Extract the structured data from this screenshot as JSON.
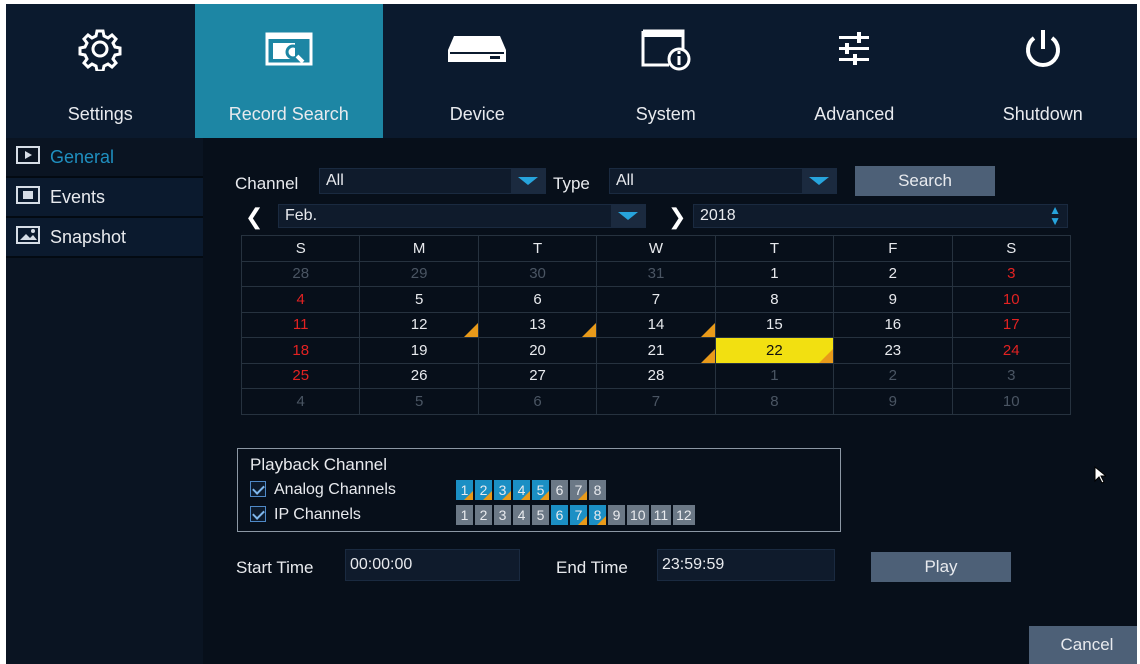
{
  "nav": [
    {
      "label": "Settings",
      "icon": "gear-icon"
    },
    {
      "label": "Record Search",
      "icon": "record-search-icon",
      "active": true
    },
    {
      "label": "Device",
      "icon": "hard-drive-icon"
    },
    {
      "label": "System",
      "icon": "system-info-icon"
    },
    {
      "label": "Advanced",
      "icon": "sliders-icon"
    },
    {
      "label": "Shutdown",
      "icon": "power-icon"
    }
  ],
  "sidebar": [
    {
      "label": "General",
      "icon": "general-icon",
      "active": true
    },
    {
      "label": "Events",
      "icon": "events-icon"
    },
    {
      "label": "Snapshot",
      "icon": "snapshot-icon"
    }
  ],
  "filters": {
    "channel_label": "Channel",
    "channel_value": "All",
    "type_label": "Type",
    "type_value": "All",
    "search_label": "Search"
  },
  "month_nav": {
    "month": "Feb.",
    "year": "2018"
  },
  "calendar": {
    "weekdays": [
      "S",
      "M",
      "T",
      "W",
      "T",
      "F",
      "S"
    ],
    "weeks": [
      [
        "28",
        "29",
        "30",
        "31",
        "1",
        "2",
        "3"
      ],
      [
        "4",
        "5",
        "6",
        "7",
        "8",
        "9",
        "10"
      ],
      [
        "11",
        "12",
        "13",
        "14",
        "15",
        "16",
        "17"
      ],
      [
        "18",
        "19",
        "20",
        "21",
        "22",
        "23",
        "24"
      ],
      [
        "25",
        "26",
        "27",
        "28",
        "1",
        "2",
        "3"
      ],
      [
        "4",
        "5",
        "6",
        "7",
        "8",
        "9",
        "10"
      ]
    ],
    "selected": "22",
    "recorded_days": [
      "12",
      "13",
      "14",
      "21",
      "22"
    ]
  },
  "playback": {
    "title": "Playback Channel",
    "analog_label": "Analog Channels",
    "ip_label": "IP Channels",
    "analog_channels": [
      "1",
      "2",
      "3",
      "4",
      "5",
      "6",
      "7",
      "8"
    ],
    "analog_on": [
      "1",
      "2",
      "3",
      "4",
      "5"
    ],
    "analog_tagged": [
      "1",
      "2",
      "3",
      "4",
      "5",
      "7"
    ],
    "ip_channels": [
      "1",
      "2",
      "3",
      "4",
      "5",
      "6",
      "7",
      "8",
      "9",
      "10",
      "11",
      "12"
    ],
    "ip_on": [
      "6",
      "7",
      "8"
    ],
    "ip_tagged": [
      "7",
      "8"
    ]
  },
  "time": {
    "start_label": "Start Time",
    "start_value": "00:00:00",
    "end_label": "End Time",
    "end_value": "23:59:59",
    "play_label": "Play"
  },
  "cancel_label": "Cancel",
  "colors": {
    "accent": "#1d86a4",
    "selected_day": "#f2e011",
    "record_marker": "#e89a1a",
    "weekend_red": "#e22222"
  }
}
